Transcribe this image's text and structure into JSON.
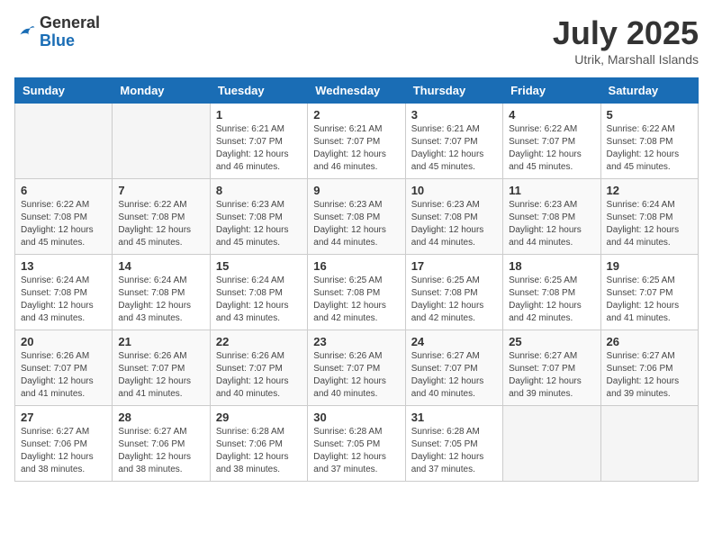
{
  "header": {
    "logo_general": "General",
    "logo_blue": "Blue",
    "month_title": "July 2025",
    "location": "Utrik, Marshall Islands"
  },
  "weekdays": [
    "Sunday",
    "Monday",
    "Tuesday",
    "Wednesday",
    "Thursday",
    "Friday",
    "Saturday"
  ],
  "weeks": [
    [
      {
        "day": "",
        "detail": ""
      },
      {
        "day": "",
        "detail": ""
      },
      {
        "day": "1",
        "detail": "Sunrise: 6:21 AM\nSunset: 7:07 PM\nDaylight: 12 hours\nand 46 minutes."
      },
      {
        "day": "2",
        "detail": "Sunrise: 6:21 AM\nSunset: 7:07 PM\nDaylight: 12 hours\nand 46 minutes."
      },
      {
        "day": "3",
        "detail": "Sunrise: 6:21 AM\nSunset: 7:07 PM\nDaylight: 12 hours\nand 45 minutes."
      },
      {
        "day": "4",
        "detail": "Sunrise: 6:22 AM\nSunset: 7:07 PM\nDaylight: 12 hours\nand 45 minutes."
      },
      {
        "day": "5",
        "detail": "Sunrise: 6:22 AM\nSunset: 7:08 PM\nDaylight: 12 hours\nand 45 minutes."
      }
    ],
    [
      {
        "day": "6",
        "detail": "Sunrise: 6:22 AM\nSunset: 7:08 PM\nDaylight: 12 hours\nand 45 minutes."
      },
      {
        "day": "7",
        "detail": "Sunrise: 6:22 AM\nSunset: 7:08 PM\nDaylight: 12 hours\nand 45 minutes."
      },
      {
        "day": "8",
        "detail": "Sunrise: 6:23 AM\nSunset: 7:08 PM\nDaylight: 12 hours\nand 45 minutes."
      },
      {
        "day": "9",
        "detail": "Sunrise: 6:23 AM\nSunset: 7:08 PM\nDaylight: 12 hours\nand 44 minutes."
      },
      {
        "day": "10",
        "detail": "Sunrise: 6:23 AM\nSunset: 7:08 PM\nDaylight: 12 hours\nand 44 minutes."
      },
      {
        "day": "11",
        "detail": "Sunrise: 6:23 AM\nSunset: 7:08 PM\nDaylight: 12 hours\nand 44 minutes."
      },
      {
        "day": "12",
        "detail": "Sunrise: 6:24 AM\nSunset: 7:08 PM\nDaylight: 12 hours\nand 44 minutes."
      }
    ],
    [
      {
        "day": "13",
        "detail": "Sunrise: 6:24 AM\nSunset: 7:08 PM\nDaylight: 12 hours\nand 43 minutes."
      },
      {
        "day": "14",
        "detail": "Sunrise: 6:24 AM\nSunset: 7:08 PM\nDaylight: 12 hours\nand 43 minutes."
      },
      {
        "day": "15",
        "detail": "Sunrise: 6:24 AM\nSunset: 7:08 PM\nDaylight: 12 hours\nand 43 minutes."
      },
      {
        "day": "16",
        "detail": "Sunrise: 6:25 AM\nSunset: 7:08 PM\nDaylight: 12 hours\nand 42 minutes."
      },
      {
        "day": "17",
        "detail": "Sunrise: 6:25 AM\nSunset: 7:08 PM\nDaylight: 12 hours\nand 42 minutes."
      },
      {
        "day": "18",
        "detail": "Sunrise: 6:25 AM\nSunset: 7:08 PM\nDaylight: 12 hours\nand 42 minutes."
      },
      {
        "day": "19",
        "detail": "Sunrise: 6:25 AM\nSunset: 7:07 PM\nDaylight: 12 hours\nand 41 minutes."
      }
    ],
    [
      {
        "day": "20",
        "detail": "Sunrise: 6:26 AM\nSunset: 7:07 PM\nDaylight: 12 hours\nand 41 minutes."
      },
      {
        "day": "21",
        "detail": "Sunrise: 6:26 AM\nSunset: 7:07 PM\nDaylight: 12 hours\nand 41 minutes."
      },
      {
        "day": "22",
        "detail": "Sunrise: 6:26 AM\nSunset: 7:07 PM\nDaylight: 12 hours\nand 40 minutes."
      },
      {
        "day": "23",
        "detail": "Sunrise: 6:26 AM\nSunset: 7:07 PM\nDaylight: 12 hours\nand 40 minutes."
      },
      {
        "day": "24",
        "detail": "Sunrise: 6:27 AM\nSunset: 7:07 PM\nDaylight: 12 hours\nand 40 minutes."
      },
      {
        "day": "25",
        "detail": "Sunrise: 6:27 AM\nSunset: 7:07 PM\nDaylight: 12 hours\nand 39 minutes."
      },
      {
        "day": "26",
        "detail": "Sunrise: 6:27 AM\nSunset: 7:06 PM\nDaylight: 12 hours\nand 39 minutes."
      }
    ],
    [
      {
        "day": "27",
        "detail": "Sunrise: 6:27 AM\nSunset: 7:06 PM\nDaylight: 12 hours\nand 38 minutes."
      },
      {
        "day": "28",
        "detail": "Sunrise: 6:27 AM\nSunset: 7:06 PM\nDaylight: 12 hours\nand 38 minutes."
      },
      {
        "day": "29",
        "detail": "Sunrise: 6:28 AM\nSunset: 7:06 PM\nDaylight: 12 hours\nand 38 minutes."
      },
      {
        "day": "30",
        "detail": "Sunrise: 6:28 AM\nSunset: 7:05 PM\nDaylight: 12 hours\nand 37 minutes."
      },
      {
        "day": "31",
        "detail": "Sunrise: 6:28 AM\nSunset: 7:05 PM\nDaylight: 12 hours\nand 37 minutes."
      },
      {
        "day": "",
        "detail": ""
      },
      {
        "day": "",
        "detail": ""
      }
    ]
  ]
}
